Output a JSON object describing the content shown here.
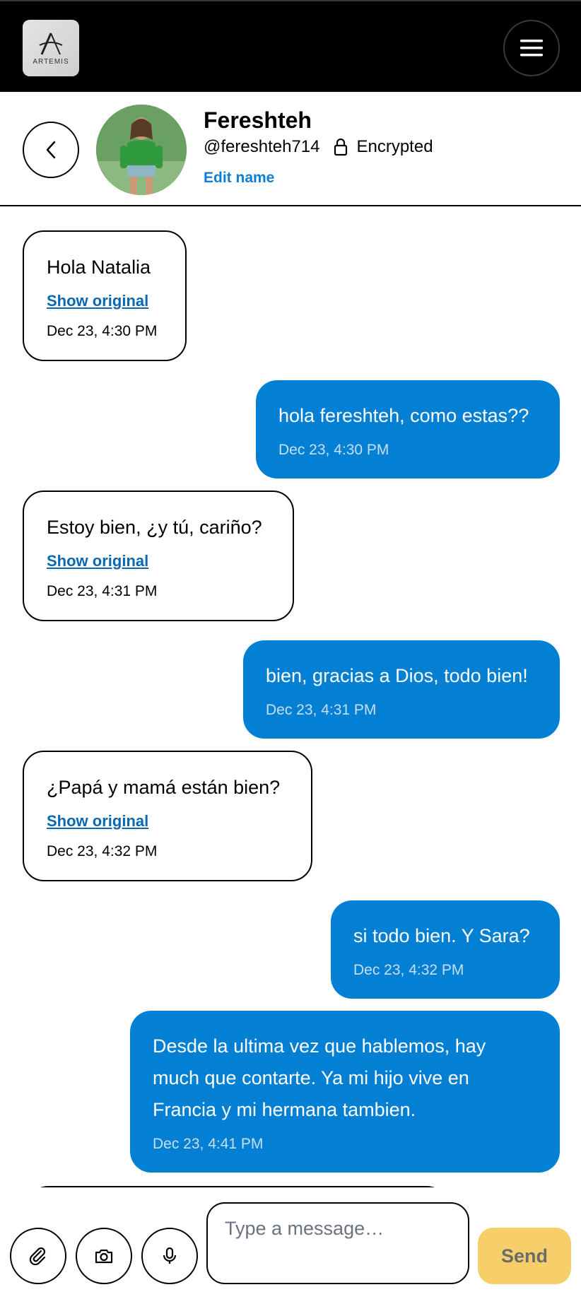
{
  "header": {
    "logo_text": "ARTEMIS",
    "menu_icon": "hamburger-icon"
  },
  "contact": {
    "name": "Fereshteh",
    "handle": "@fereshteh714",
    "encrypted_label": "Encrypted",
    "edit_label": "Edit name",
    "lock_icon": "lock-icon",
    "back_icon": "chevron-left-icon"
  },
  "messages": [
    {
      "direction": "in",
      "text": "Hola Natalia",
      "show_original": "Show original",
      "time": "Dec 23, 4:30 PM"
    },
    {
      "direction": "out",
      "text": "hola fereshteh, como estas??",
      "time": "Dec 23, 4:30 PM"
    },
    {
      "direction": "in",
      "text": "Estoy bien, ¿y tú, cariño?",
      "show_original": "Show original",
      "time": "Dec 23, 4:31 PM"
    },
    {
      "direction": "out",
      "text": "bien, gracias a Dios, todo bien!",
      "time": "Dec 23, 4:31 PM"
    },
    {
      "direction": "in",
      "text": "¿Papá y mamá están bien?",
      "show_original": "Show original",
      "time": "Dec 23, 4:32 PM"
    },
    {
      "direction": "out",
      "text": "si todo bien. Y Sara?",
      "time": "Dec 23, 4:32 PM"
    },
    {
      "direction": "out",
      "text": "Desde la ultima vez que hablemos, hay much que contarte. Ya mi hijo vive en Francia y mi hermana tambien.",
      "time": "Dec 23, 4:41 PM"
    }
  ],
  "composer": {
    "placeholder": "Type a message…",
    "send_label": "Send",
    "attach_icon": "paperclip-icon",
    "camera_icon": "camera-icon",
    "mic_icon": "microphone-icon"
  },
  "colors": {
    "outgoing_bubble": "#0380d3",
    "link": "#0a7fd6",
    "send_button": "#f6cf6a",
    "topbar": "#000000"
  }
}
